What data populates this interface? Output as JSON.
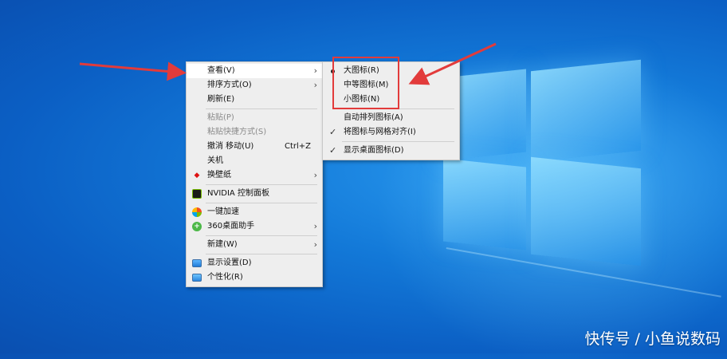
{
  "context_menu": {
    "items": [
      {
        "label": "查看(V)",
        "has_submenu": true,
        "highlight": true
      },
      {
        "label": "排序方式(O)",
        "has_submenu": true
      },
      {
        "label": "刷新(E)"
      },
      {
        "label": "粘贴(P)",
        "disabled": true
      },
      {
        "label": "粘贴快捷方式(S)",
        "disabled": true
      },
      {
        "label": "撤消 移动(U)",
        "shortcut": "Ctrl+Z"
      },
      {
        "label": "关机"
      },
      {
        "label": "换壁纸",
        "has_submenu": true,
        "icon": "wallpaper-icon"
      },
      {
        "label": "NVIDIA 控制面板",
        "icon": "nvidia-icon"
      },
      {
        "label": "一键加速",
        "icon": "speedup-icon"
      },
      {
        "label": "360桌面助手",
        "has_submenu": true,
        "icon": "360-assistant-icon"
      },
      {
        "label": "新建(W)",
        "has_submenu": true
      },
      {
        "label": "显示设置(D)",
        "icon": "display-settings-icon"
      },
      {
        "label": "个性化(R)",
        "icon": "personalize-icon"
      }
    ]
  },
  "view_submenu": {
    "items": [
      {
        "label": "大图标(R)",
        "selected": true
      },
      {
        "label": "中等图标(M)"
      },
      {
        "label": "小图标(N)"
      },
      {
        "label": "自动排列图标(A)"
      },
      {
        "label": "将图标与网格对齐(I)",
        "checked": true
      },
      {
        "label": "显示桌面图标(D)",
        "checked": true
      }
    ]
  },
  "watermark": "快传号 / 小鱼说数码",
  "colors": {
    "annotation_red": "#e23b3b",
    "desktop_blue": "#1379d8"
  }
}
